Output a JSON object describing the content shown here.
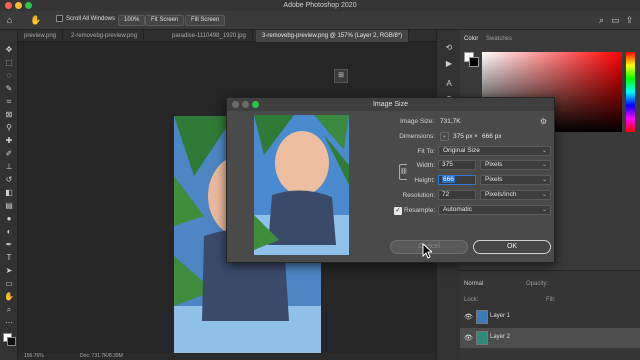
{
  "app": {
    "title": "Adobe Photoshop 2020",
    "traffic_colors": [
      "#fe5f57",
      "#febc2e",
      "#28c840"
    ]
  },
  "options_bar": {
    "scroll_all_windows": "Scroll All Windows",
    "zoom_button": "100%",
    "fit_screen": "Fit Screen",
    "fill_screen": "Fill Screen"
  },
  "tabs": [
    {
      "label": "preview.png"
    },
    {
      "label": "2-removebg-preview.png"
    },
    {
      "label": "paradise-1110498_1920.jpg"
    },
    {
      "label": "3-removebg-preview.png @ 157% (Layer 2, RGB/8*)"
    }
  ],
  "status": {
    "zoom": "156.76%",
    "doc": "Doc: 731.7K/8.39M"
  },
  "panels": {
    "color_tab": "Color",
    "swatches_tab": "Swatches",
    "opacity_label": "Opacity:",
    "fill_label": "Fill:",
    "normal_mode": "Normal",
    "lock_label": "Lock:",
    "layers": [
      {
        "name": "Layer 1"
      },
      {
        "name": "Layer 2"
      }
    ]
  },
  "dialog": {
    "title": "Image Size",
    "image_size_label": "Image Size:",
    "image_size_value": "731,7K",
    "dimensions_label": "Dimensions:",
    "dimensions_w": "375 px",
    "dimensions_x": "×",
    "dimensions_h": "666 px",
    "fit_to_label": "Fit To:",
    "fit_to_value": "Original Size",
    "width_label": "Width:",
    "width_value": "375",
    "width_unit": "Pixels",
    "height_label": "Height:",
    "height_value": "666",
    "height_unit": "Pixels",
    "resolution_label": "Resolution:",
    "resolution_value": "72",
    "resolution_unit": "Pixels/Inch",
    "resample_label": "Resample:",
    "resample_value": "Automatic",
    "cancel": "Cancel",
    "ok": "OK"
  }
}
